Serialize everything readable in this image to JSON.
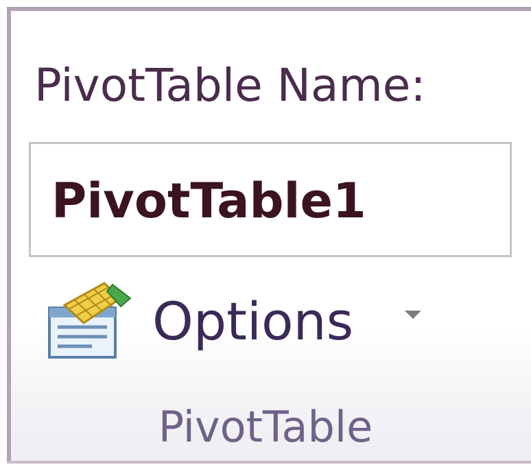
{
  "pivottable_group": {
    "name_label": "PivotTable Name:",
    "name_value": "PivotTable1",
    "options_label": "Options",
    "options_icon": "pivot-options-icon",
    "dropdown_icon": "chevron-down-icon",
    "caption": "PivotTable"
  },
  "colors": {
    "group_border": "#b3a3b6",
    "label_text": "#4a2c4c",
    "caption_text": "#6f6287"
  }
}
